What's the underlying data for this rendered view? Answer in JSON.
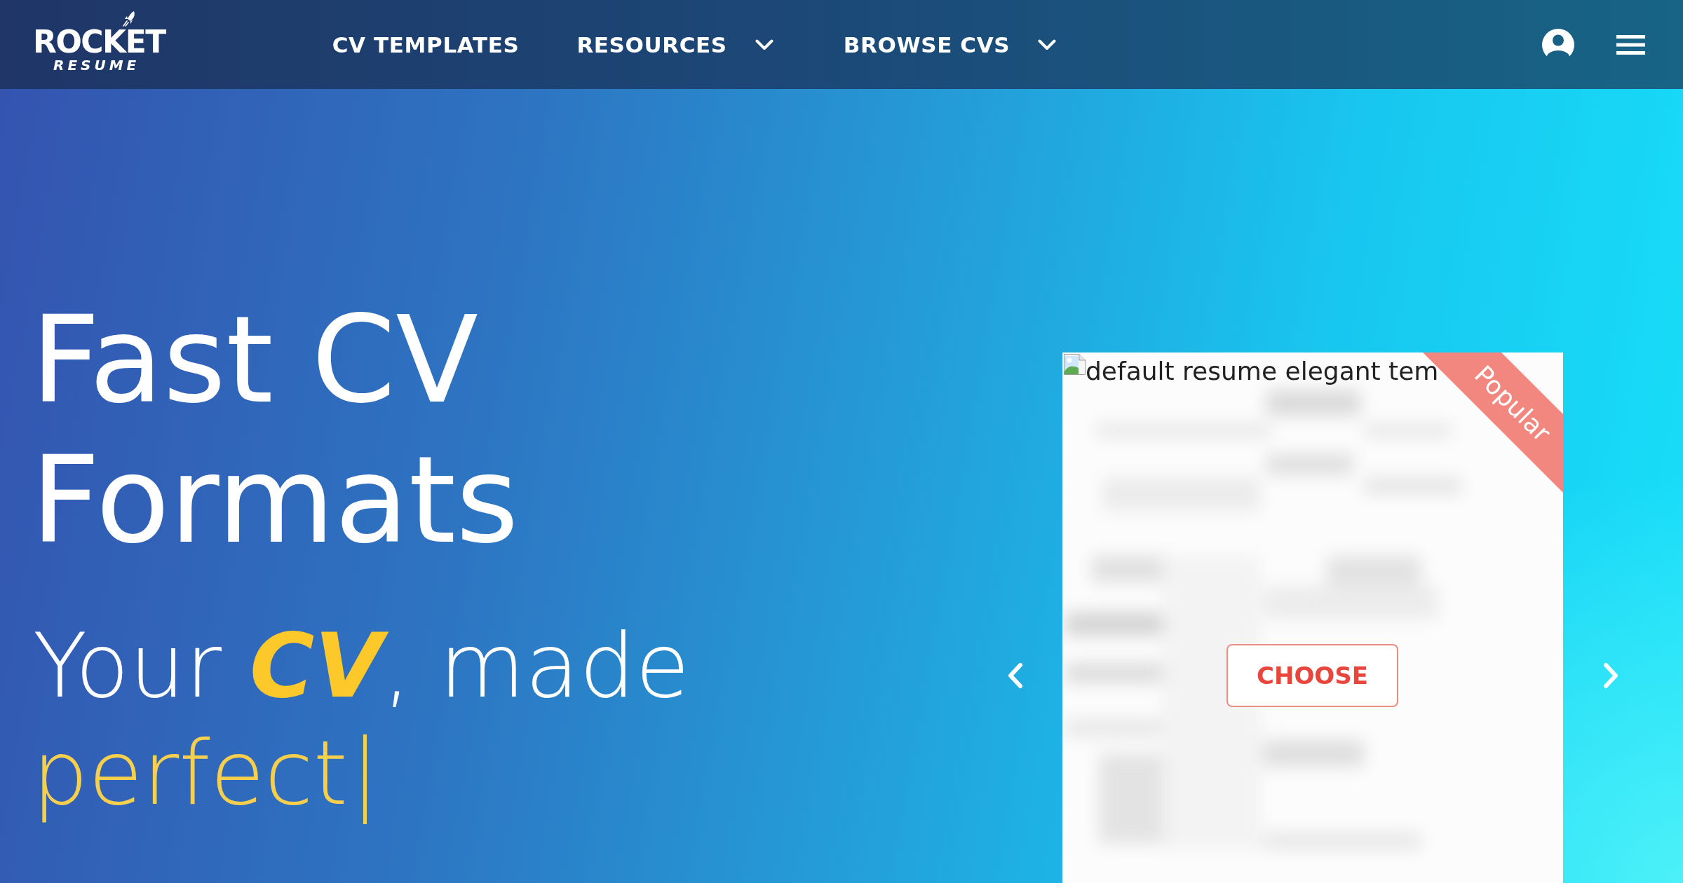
{
  "header": {
    "logo": {
      "wordmark": "ROCKET",
      "tagline": "RESUME"
    },
    "nav": [
      {
        "label": "CV TEMPLATES",
        "kind": "link"
      },
      {
        "label": "RESOURCES",
        "kind": "dropdown"
      },
      {
        "label": "BROWSE CVS",
        "kind": "dropdown"
      }
    ]
  },
  "hero": {
    "title": "Fast CV Formats",
    "tagline": "Your **CV**, made",
    "typed_word": "perfect"
  },
  "carousel": {
    "cards": [
      {
        "image_alt": "default resume elegant tem",
        "ribbon": "Popular",
        "button": "CHOOSE"
      }
    ]
  }
}
